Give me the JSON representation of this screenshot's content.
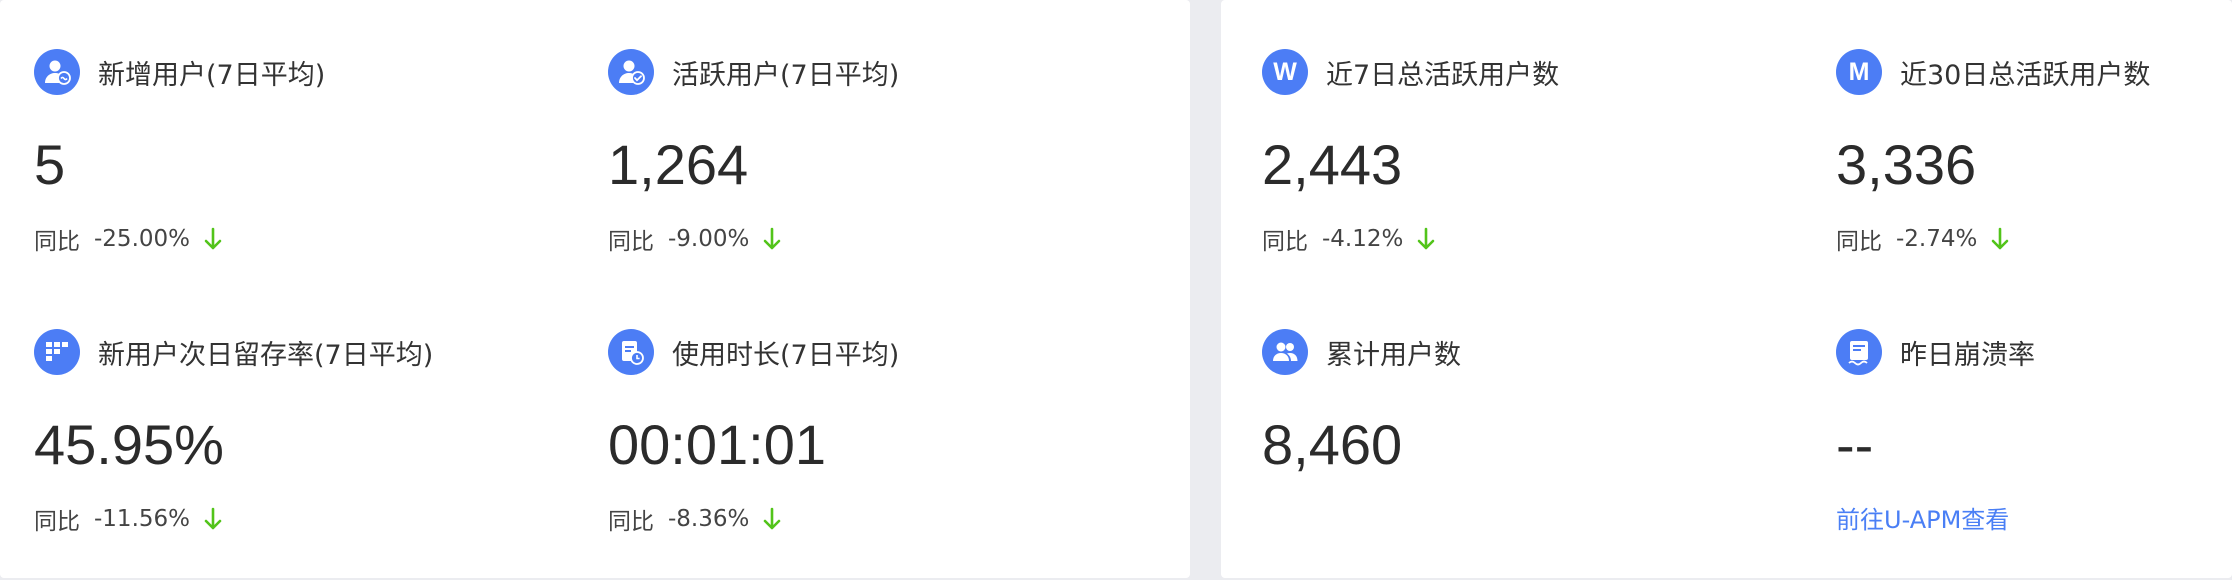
{
  "colors": {
    "accent": "#4c7df5",
    "down_arrow": "#52c41a",
    "link": "#4a7ff5"
  },
  "cards": {
    "new_users": {
      "icon": "new-user-icon",
      "title": "新增用户(7日平均)",
      "value": "5",
      "compare_label": "同比",
      "compare_value": "-25.00%",
      "trend": "down"
    },
    "active_users": {
      "icon": "active-user-icon",
      "title": "活跃用户(7日平均)",
      "value": "1,264",
      "compare_label": "同比",
      "compare_value": "-9.00%",
      "trend": "down"
    },
    "retention": {
      "icon": "retention-grid-icon",
      "title": "新用户次日留存率(7日平均)",
      "value": "45.95%",
      "compare_label": "同比",
      "compare_value": "-11.56%",
      "trend": "down"
    },
    "duration": {
      "icon": "usage-time-icon",
      "title": "使用时长(7日平均)",
      "value": "00:01:01",
      "compare_label": "同比",
      "compare_value": "-8.36%",
      "trend": "down"
    },
    "weekly_active": {
      "icon_letter": "W",
      "title": "近7日总活跃用户数",
      "value": "2,443",
      "compare_label": "同比",
      "compare_value": "-4.12%",
      "trend": "down"
    },
    "monthly_active": {
      "icon_letter": "M",
      "title": "近30日总活跃用户数",
      "value": "3,336",
      "compare_label": "同比",
      "compare_value": "-2.74%",
      "trend": "down"
    },
    "total_users": {
      "icon": "users-group-icon",
      "title": "累计用户数",
      "value": "8,460"
    },
    "crash_rate": {
      "icon": "crash-report-icon",
      "title": "昨日崩溃率",
      "value": "--",
      "link_text": "前往U-APM查看"
    }
  }
}
